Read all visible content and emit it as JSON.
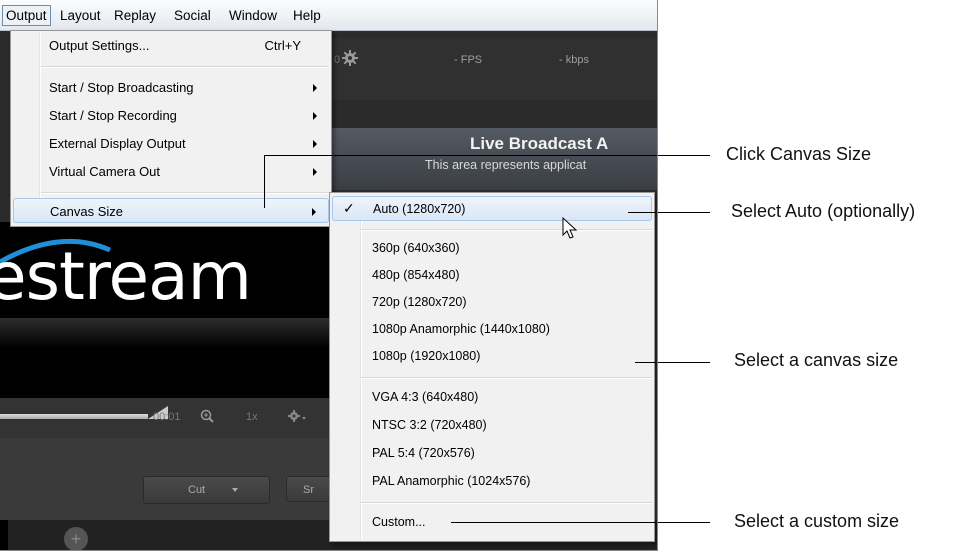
{
  "menubar": {
    "items": [
      "Output",
      "Layout",
      "Replay",
      "Social",
      "Window",
      "Help"
    ]
  },
  "toolbar": {
    "fps": "- FPS",
    "kbps": "- kbps",
    "frag": "0"
  },
  "preview": {
    "title": "Live Broadcast A",
    "subtitle": "This area represents applicat"
  },
  "logo": {
    "text": "estream"
  },
  "transport": {
    "time": "00:01",
    "speed": "1x"
  },
  "lower": {
    "cut_label": "Cut",
    "btn2_label": "Sr"
  },
  "output_menu": {
    "output_settings": "Output Settings...",
    "output_settings_shortcut": "Ctrl+Y",
    "start_stop_broadcasting": "Start / Stop Broadcasting",
    "start_stop_recording": "Start / Stop Recording",
    "external_display_output": "External Display Output",
    "virtual_camera_out": "Virtual Camera Out",
    "canvas_size": "Canvas Size"
  },
  "canvas_size_menu": {
    "auto": "Auto (1280x720)",
    "p360": "360p (640x360)",
    "p480": "480p (854x480)",
    "p720": "720p (1280x720)",
    "p1080_anamorphic": "1080p Anamorphic (1440x1080)",
    "p1080": "1080p (1920x1080)",
    "vga": "VGA 4:3 (640x480)",
    "ntsc": "NTSC 3:2 (720x480)",
    "pal": "PAL 5:4 (720x576)",
    "pal_anamorphic": "PAL Anamorphic (1024x576)",
    "custom": "Custom..."
  },
  "annotations": {
    "click_canvas": "Click Canvas Size",
    "select_auto": "Select Auto (optionally)",
    "select_canvas": "Select a canvas size",
    "select_custom": "Select a custom size"
  },
  "colors": {
    "menu_bg": "#f1f1f1",
    "highlight": "#d9e7f6",
    "app_bg": "#2b2b2b"
  },
  "icons": [
    "gear-icon",
    "zoom-icon",
    "settings-dropdown-icon",
    "checkmark-icon",
    "submenu-arrow-icon",
    "mouse-pointer-icon",
    "add-icon"
  ]
}
